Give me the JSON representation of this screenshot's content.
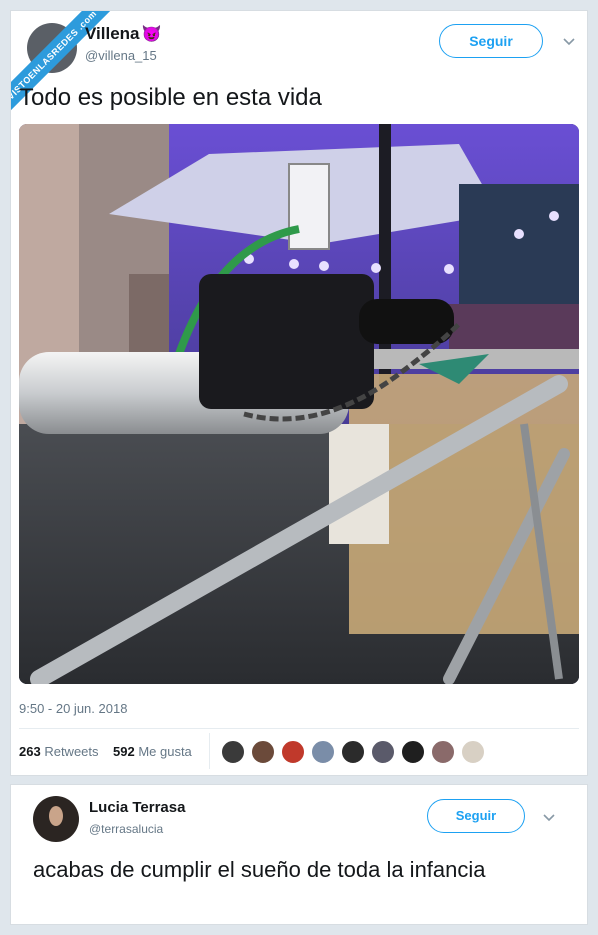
{
  "watermark": "VISTOENLASREDES .com",
  "tweet1": {
    "name": "Villena",
    "emoji": "😈",
    "handle": "@villena_15",
    "follow_label": "Seguir",
    "text": "Todo es posible en esta vida",
    "timestamp": "9:50 - 20 jun. 2018",
    "retweets_count": "263",
    "retweets_label": "Retweets",
    "likes_count": "592",
    "likes_label": "Me gusta",
    "liker_colors": [
      "#3a3a3a",
      "#6b4a3a",
      "#c0392b",
      "#7a8da8",
      "#2b2b2b",
      "#5a5a6a",
      "#1f1f1f",
      "#8a6a6a",
      "#d8d0c4"
    ]
  },
  "tweet2": {
    "name": "Lucia Terrasa",
    "handle": "@terrasalucia",
    "follow_label": "Seguir",
    "text": "acabas de cumplir el sueño de toda la infancia"
  }
}
